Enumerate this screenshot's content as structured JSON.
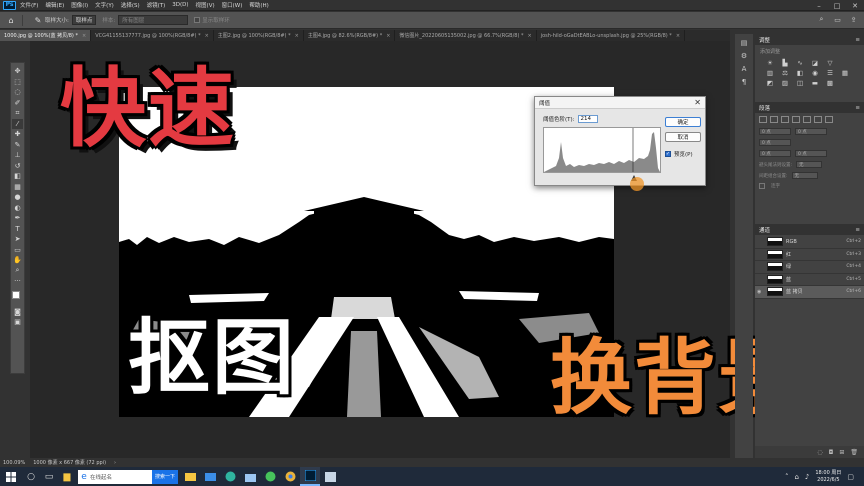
{
  "menubar": {
    "logo": "Ps",
    "items": [
      "文件(F)",
      "编辑(E)",
      "图像(I)",
      "文字(Y)",
      "选择(S)",
      "滤镜(T)",
      "3D(D)",
      "视图(V)",
      "窗口(W)",
      "帮助(H)"
    ]
  },
  "options": {
    "sample_size_label": "取样大小:",
    "sample_size_value": "取样点",
    "sample_label": "样本:",
    "sample_value": "所有图层",
    "ring_label": "显示取样环"
  },
  "tabs": [
    {
      "label": "1000.jpg @ 100%(蓝 拷贝/8) *",
      "active": true
    },
    {
      "label": "VCG41155137777.jpg @ 100%(RGB/8#) *",
      "active": false
    },
    {
      "label": "主图2.jpg @ 100%(RGB/8#) *",
      "active": false
    },
    {
      "label": "主图4.jpg @ 82.6%(RGB/8#) *",
      "active": false
    },
    {
      "label": "微信图片_20220605135002.jpg @ 66.7%(RGB/8) *",
      "active": false
    },
    {
      "label": "josh-hild-oGaDtEABLo-unsplash.jpg @ 25%(RGB/8) *",
      "active": false
    }
  ],
  "overlay": {
    "title_red": "快速",
    "title_white": "抠图",
    "title_orange": "换背景"
  },
  "dialog": {
    "title": "阈值",
    "threshold_label": "阈值色阶(T):",
    "threshold_value": "214",
    "ok": "确定",
    "cancel": "取消",
    "preview": "预览(P)"
  },
  "panels": {
    "adjust_title": "调整",
    "adjust_sub": "添加调整",
    "para_title": "段落",
    "field_zero": "0 点",
    "hyphen_label_1": "避头尾法则设置:",
    "hyphen_label_2": "间距组合设置:",
    "none_value": "无",
    "hyphenate": "连字",
    "channels_title": "通道",
    "channels": [
      {
        "name": "RGB",
        "key": "Ctrl+2",
        "active": false
      },
      {
        "name": "红",
        "key": "Ctrl+3",
        "active": false
      },
      {
        "name": "绿",
        "key": "Ctrl+4",
        "active": false
      },
      {
        "name": "蓝",
        "key": "Ctrl+5",
        "active": false
      },
      {
        "name": "蓝 拷贝",
        "key": "Ctrl+6",
        "active": true
      }
    ]
  },
  "status": {
    "zoom": "100.09%",
    "doc_info": "1000 像素 x 667 像素 (72 ppi)"
  },
  "taskbar": {
    "search_placeholder": "在线起名",
    "search_button": "搜索一下",
    "time": "18:00 周日",
    "date": "2022/6/5"
  }
}
